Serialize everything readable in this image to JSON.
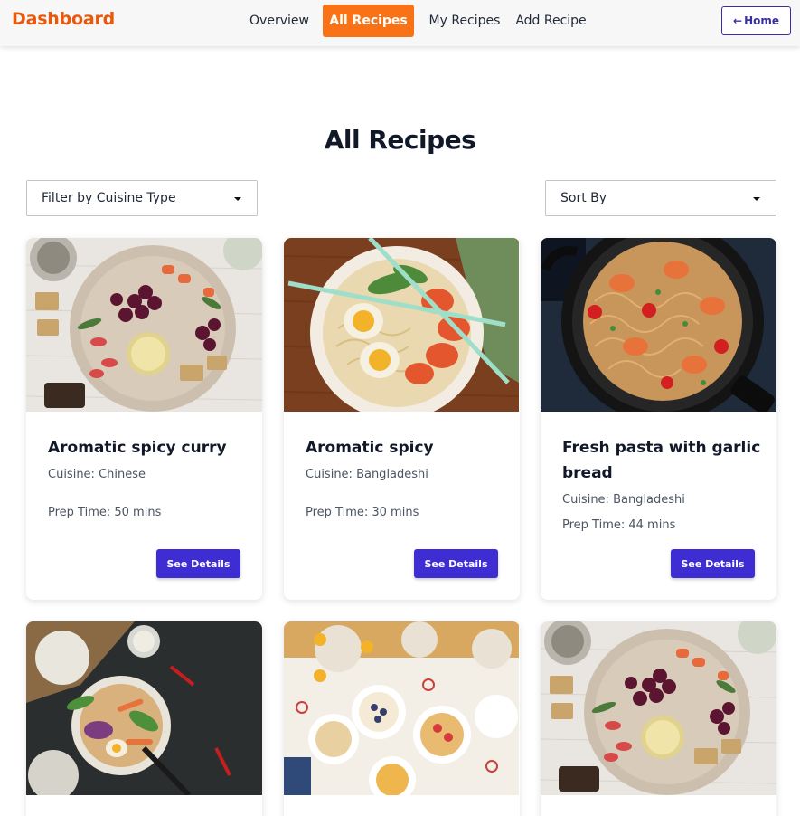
{
  "app": {
    "brand": "Dashboard"
  },
  "nav": {
    "links": [
      {
        "label": "Overview",
        "active": false
      },
      {
        "label": "All Recipes",
        "active": true
      },
      {
        "label": "My Recipes",
        "active": false
      },
      {
        "label": "Add Recipe",
        "active": false
      }
    ],
    "home": {
      "icon": "arrow-left-icon",
      "label": "Home"
    }
  },
  "colors": {
    "brand": "#ea580c",
    "active_tab": "#f97316",
    "primary_button": "#3f2dd4",
    "home_border": "#3730a3"
  },
  "page": {
    "title": "All Recipes"
  },
  "filters": {
    "cuisine": {
      "label": "Filter by Cuisine Type"
    },
    "sort": {
      "label": "Sort By"
    }
  },
  "recipes": [
    {
      "title": "Aromatic spicy curry",
      "cuisine": "Cuisine: Chinese",
      "prep": "Prep Time: 50 mins",
      "button": "See Details",
      "image": "charcuterie-board-photo"
    },
    {
      "title": "Aromatic spicy",
      "cuisine": "Cuisine: Bangladeshi",
      "prep": "Prep Time: 30 mins",
      "button": "See Details",
      "image": "ramen-bowl-photo"
    },
    {
      "title": "Fresh pasta with garlic bread",
      "cuisine": "Cuisine: Bangladeshi",
      "prep": "Prep Time: 44 mins",
      "button": "See Details",
      "image": "shrimp-pasta-pan-photo"
    },
    {
      "image": "asian-bowl-photo"
    },
    {
      "image": "brunch-table-photo"
    },
    {
      "image": "charcuterie-board-photo"
    }
  ]
}
